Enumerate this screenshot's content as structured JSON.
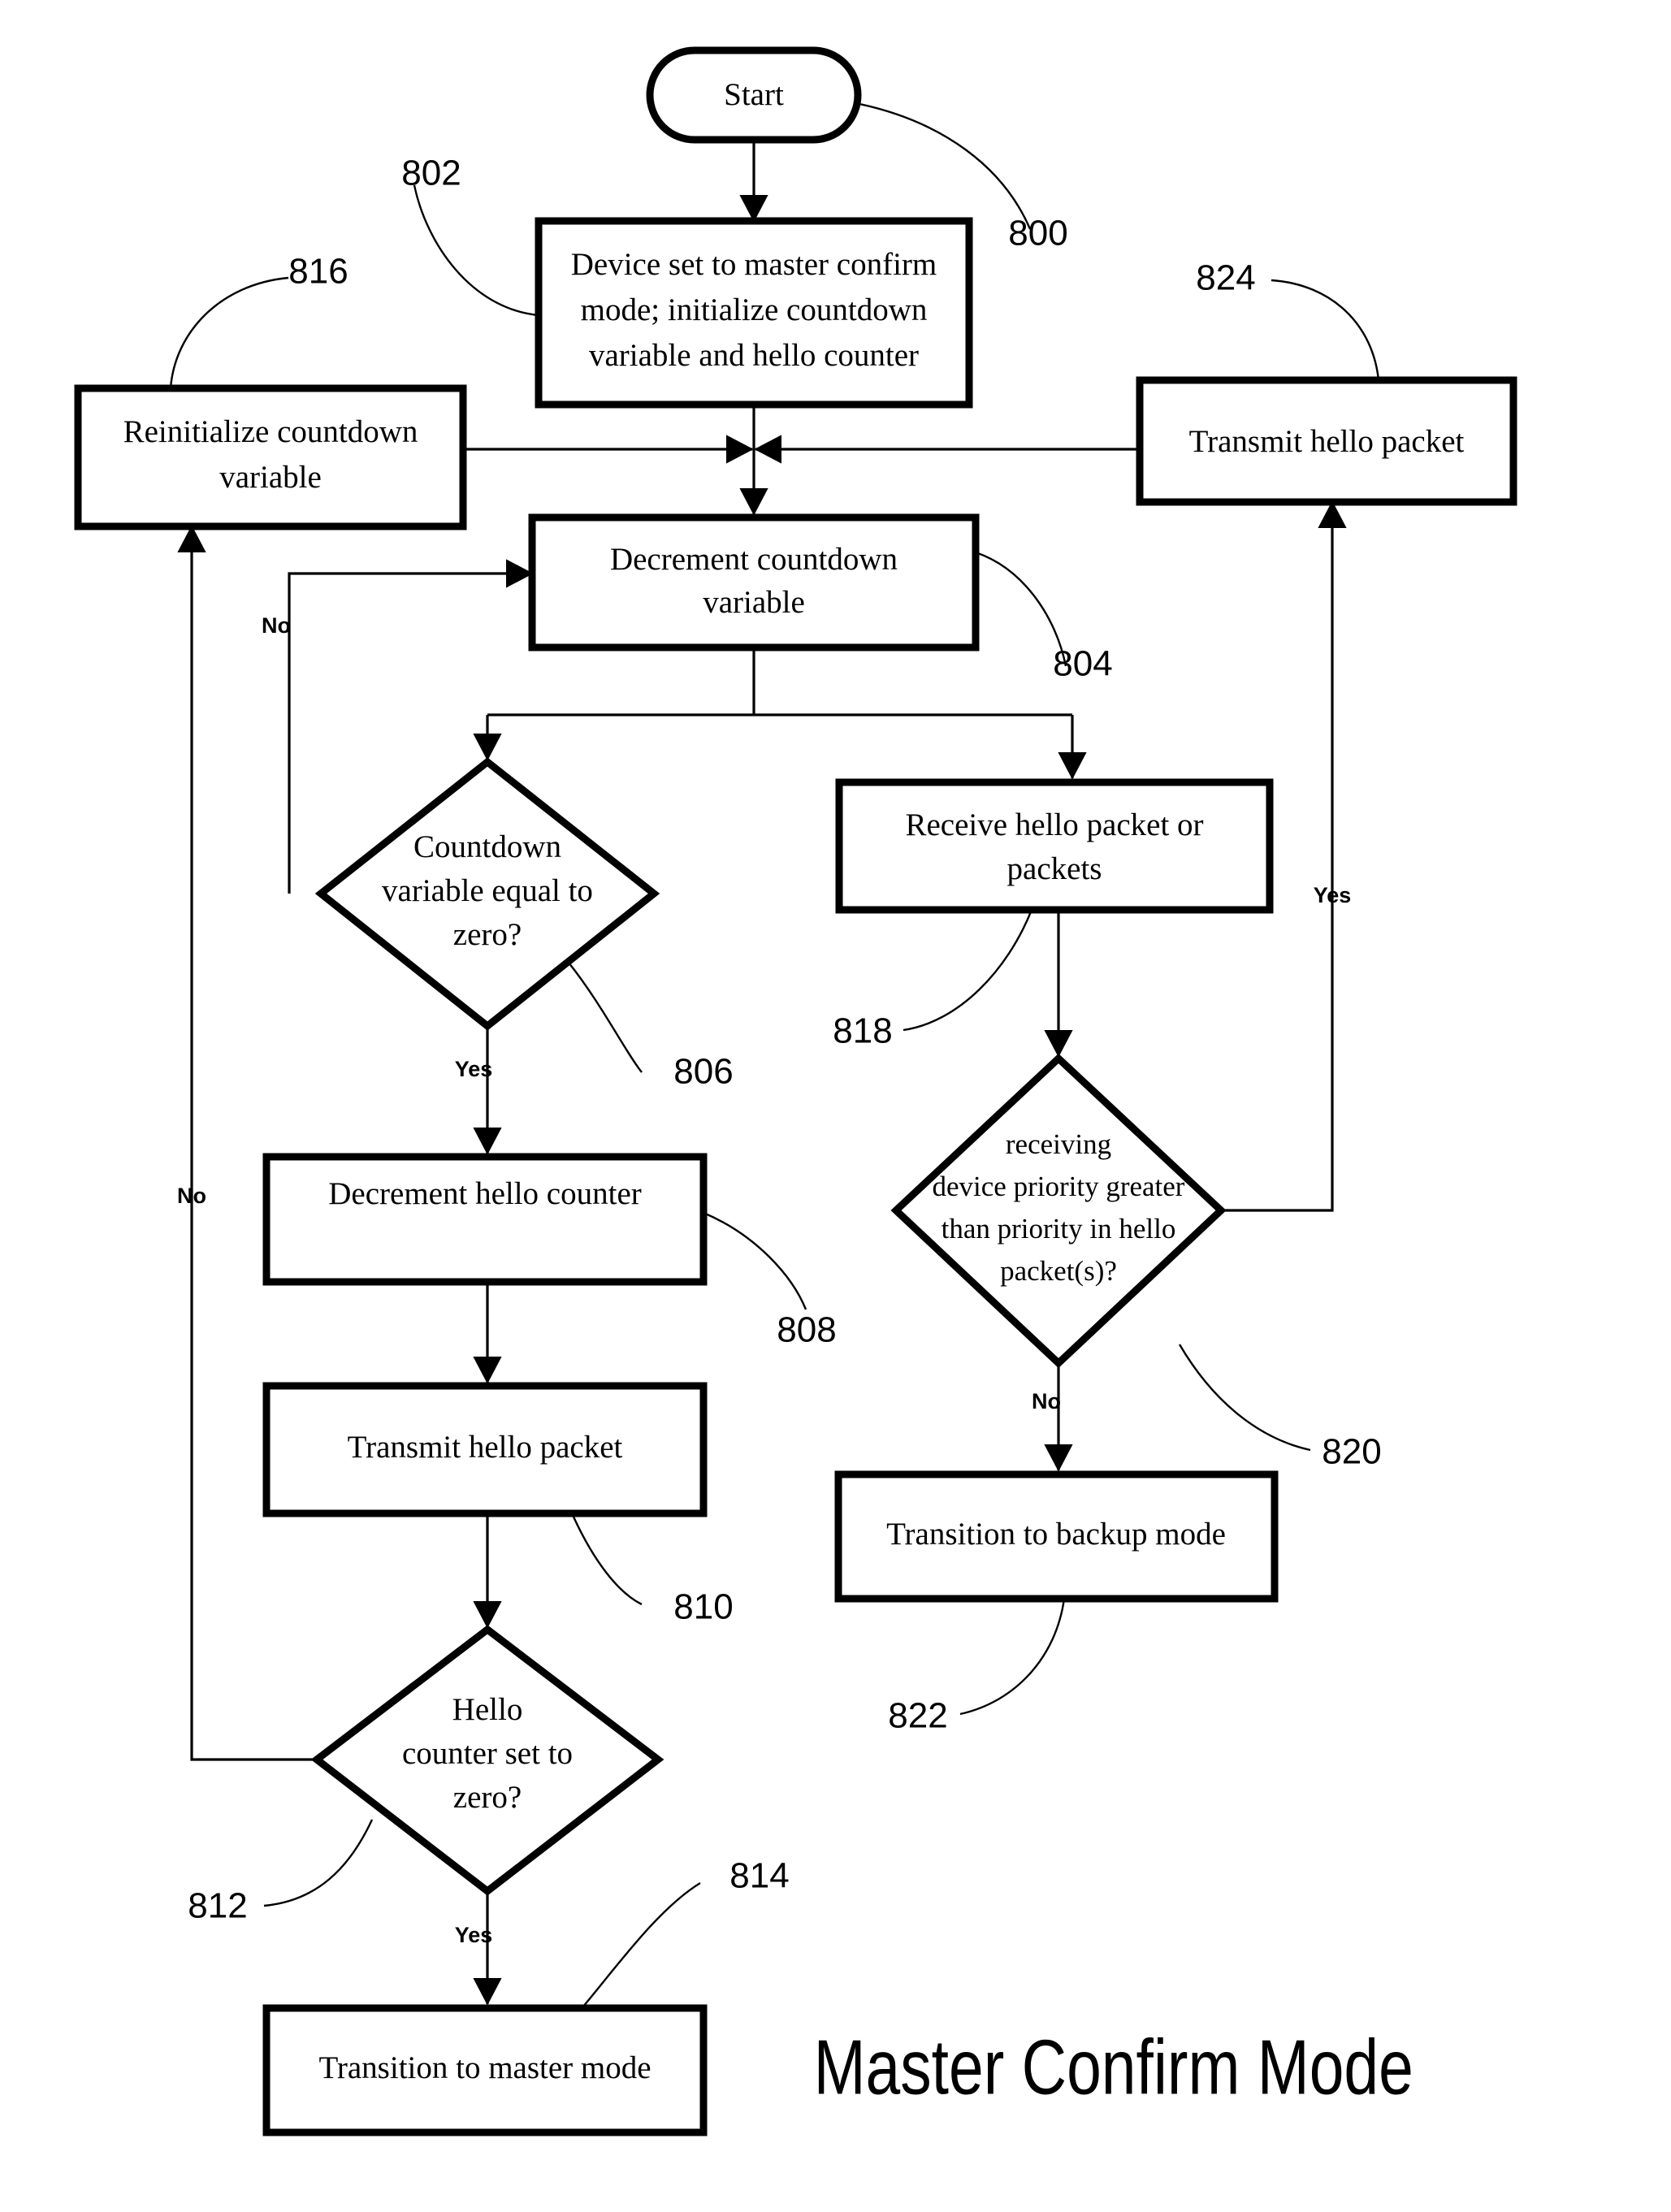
{
  "diagram": {
    "title": "Master Confirm Mode",
    "branch_labels": {
      "yes": "Yes",
      "no": "No"
    },
    "nodes": [
      {
        "id": "start",
        "shape": "terminator",
        "label": "Start",
        "ref": "800"
      },
      {
        "id": "init",
        "shape": "process",
        "label_lines": [
          "Device set to master confirm",
          "mode; initialize countdown",
          "variable and hello counter"
        ],
        "ref": "802"
      },
      {
        "id": "reinit",
        "shape": "process",
        "label_lines": [
          "Reinitialize countdown",
          "variable"
        ],
        "ref": "816"
      },
      {
        "id": "tx_hello_r",
        "shape": "process",
        "label_lines": [
          "Transmit hello packet"
        ],
        "ref": "824"
      },
      {
        "id": "decrement_cv",
        "shape": "process",
        "label_lines": [
          "Decrement countdown",
          "variable"
        ],
        "ref": "804"
      },
      {
        "id": "cv_zero",
        "shape": "decision",
        "label_lines": [
          "Countdown",
          "variable equal to",
          "zero?"
        ],
        "ref": "806"
      },
      {
        "id": "rx_hello",
        "shape": "process",
        "label_lines": [
          "Receive hello packet or",
          "packets"
        ],
        "ref": "818"
      },
      {
        "id": "prio_cmp",
        "shape": "decision",
        "label_lines": [
          "receiving",
          "device priority greater",
          "than priority in hello",
          "packet(s)?"
        ],
        "ref": "820"
      },
      {
        "id": "dec_hello",
        "shape": "process",
        "label_lines": [
          "Decrement hello counter"
        ],
        "ref": "808"
      },
      {
        "id": "tx_hello_l",
        "shape": "process",
        "label_lines": [
          "Transmit hello packet"
        ],
        "ref": "810"
      },
      {
        "id": "hc_zero",
        "shape": "decision",
        "label_lines": [
          "Hello",
          "counter set to",
          "zero?"
        ],
        "ref": "812"
      },
      {
        "id": "to_master",
        "shape": "process",
        "label_lines": [
          "Transition to master mode"
        ],
        "ref": "814"
      },
      {
        "id": "to_backup",
        "shape": "process",
        "label_lines": [
          "Transition to backup mode"
        ],
        "ref": "822"
      }
    ],
    "ref_numbers": [
      "800",
      "802",
      "804",
      "806",
      "808",
      "810",
      "812",
      "814",
      "816",
      "818",
      "820",
      "822",
      "824"
    ],
    "edges": [
      {
        "from": "start",
        "to": "init",
        "label": ""
      },
      {
        "from": "init",
        "to": "decrement_cv",
        "label": ""
      },
      {
        "from": "reinit",
        "to": "decrement_cv",
        "label": ""
      },
      {
        "from": "tx_hello_r",
        "to": "decrement_cv",
        "label": ""
      },
      {
        "from": "decrement_cv",
        "to": "cv_zero",
        "label": ""
      },
      {
        "from": "decrement_cv",
        "to": "rx_hello",
        "label": ""
      },
      {
        "from": "cv_zero",
        "to": "decrement_cv",
        "label": "No"
      },
      {
        "from": "cv_zero",
        "to": "dec_hello",
        "label": "Yes"
      },
      {
        "from": "dec_hello",
        "to": "tx_hello_l",
        "label": ""
      },
      {
        "from": "tx_hello_l",
        "to": "hc_zero",
        "label": ""
      },
      {
        "from": "hc_zero",
        "to": "reinit",
        "label": "No"
      },
      {
        "from": "hc_zero",
        "to": "to_master",
        "label": "Yes"
      },
      {
        "from": "rx_hello",
        "to": "prio_cmp",
        "label": ""
      },
      {
        "from": "prio_cmp",
        "to": "tx_hello_r",
        "label": "Yes"
      },
      {
        "from": "prio_cmp",
        "to": "to_backup",
        "label": "No"
      }
    ]
  }
}
